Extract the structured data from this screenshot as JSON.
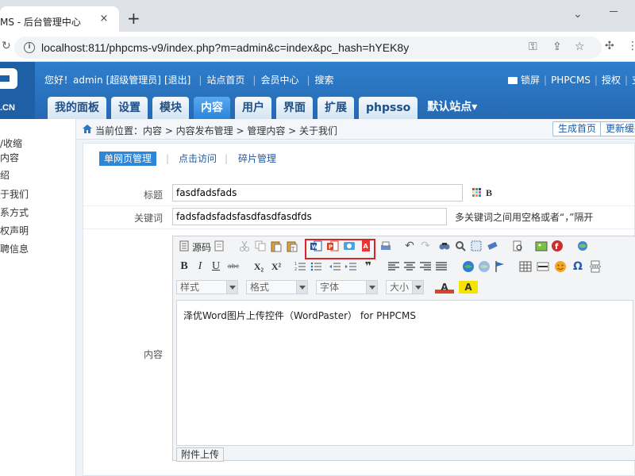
{
  "browser": {
    "tab_title": "MS - 后台管理中心",
    "tab_close": "×",
    "new_tab": "+",
    "url": "localhost:811/phpcms-v9/index.php?m=admin&c=index&pc_hash=hYEK8y"
  },
  "header": {
    "logo_text": ".CN",
    "greeting": "您好！admin",
    "role": "[超级管理员]",
    "logout": "[退出]",
    "site_home": "站点首页",
    "member_center": "会员中心",
    "search": "搜索",
    "lock_screen": "锁屏",
    "phpcms": "PHPCMS",
    "license": "授权",
    "support": "支持"
  },
  "nav": {
    "tabs": [
      {
        "label": "我的面板"
      },
      {
        "label": "设置"
      },
      {
        "label": "模块"
      },
      {
        "label": "内容"
      },
      {
        "label": "用户"
      },
      {
        "label": "界面"
      },
      {
        "label": "扩展"
      },
      {
        "label": "phpsso"
      }
    ],
    "active_tab": "内容",
    "site_select": "默认站点▾"
  },
  "sidebar": {
    "items": [
      {
        "label": "/收缩"
      },
      {
        "label": "内容"
      },
      {
        "label": "绍"
      },
      {
        "label": "于我们"
      },
      {
        "label": "系方式"
      },
      {
        "label": "权声明"
      },
      {
        "label": "聘信息"
      }
    ]
  },
  "breadcrumb": {
    "text": "当前位置：内容 > 内容发布管理 > 管理内容 > 关于我们",
    "btn_generate_home": "生成首页",
    "btn_update_cache": "更新缓存"
  },
  "subnav": {
    "single_page": "单网页管理",
    "visit": "点击访问",
    "fragment": "碎片管理"
  },
  "form": {
    "title_label": "标题",
    "title_value": "fasdfadsfads",
    "keywords_label": "关键词",
    "keywords_value": "fadsfadsfadsfasdfasdfasdfds",
    "keywords_hint": "多关键词之间用空格或者“，”隔开",
    "content_label": "内容",
    "bold_label": "B"
  },
  "editor": {
    "source_label": "源码",
    "style_placeholder": "样式",
    "format_placeholder": "格式",
    "font_placeholder": "字体",
    "size_placeholder": "大小",
    "body_text": "泽优Word图片上传控件（WordPaster） for PHPCMS",
    "upload_button": "附件上传",
    "text_color_icon": "A",
    "bg_color_icon": "A",
    "subscript": "X₂",
    "superscript": "X²",
    "omega": "Ω",
    "bold_btn": "B",
    "italic_btn": "I",
    "underline_btn": "U",
    "strike_btn": "abc"
  },
  "colors": {
    "header_blue": "#2a77c4",
    "active_tab": "#2a85dc",
    "highlight_red": "#d8252b"
  }
}
